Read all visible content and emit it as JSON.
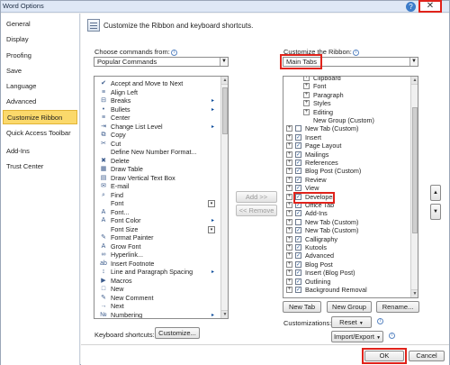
{
  "window": {
    "title": "Word Options",
    "help_glyph": "?",
    "close_glyph": "✕"
  },
  "sidebar": {
    "items": [
      {
        "label": "General"
      },
      {
        "label": "Display"
      },
      {
        "label": "Proofing"
      },
      {
        "label": "Save"
      },
      {
        "label": "Language"
      },
      {
        "label": "Advanced"
      },
      {
        "label": "Customize Ribbon",
        "active": true
      },
      {
        "label": "Quick Access Toolbar"
      },
      {
        "label": "Add-Ins"
      },
      {
        "label": "Trust Center"
      }
    ]
  },
  "header": {
    "text": "Customize the Ribbon and keyboard shortcuts."
  },
  "left_panel": {
    "choose_label": "Choose commands from:",
    "choose_value": "Popular Commands",
    "commands": [
      {
        "label": "Accept and Move to Next",
        "icon": "✔",
        "sub": ""
      },
      {
        "label": "Align Left",
        "icon": "≡",
        "sub": ""
      },
      {
        "label": "Breaks",
        "icon": "⊟",
        "sub": "▸"
      },
      {
        "label": "Bullets",
        "icon": "•",
        "sub": "▸"
      },
      {
        "label": "Center",
        "icon": "≡",
        "sub": ""
      },
      {
        "label": "Change List Level",
        "icon": "⇥",
        "sub": "▸"
      },
      {
        "label": "Copy",
        "icon": "⧉",
        "sub": ""
      },
      {
        "label": "Cut",
        "icon": "✂",
        "sub": ""
      },
      {
        "label": "Define New Number Format...",
        "icon": "",
        "sub": ""
      },
      {
        "label": "Delete",
        "icon": "✖",
        "sub": ""
      },
      {
        "label": "Draw Table",
        "icon": "▦",
        "sub": ""
      },
      {
        "label": "Draw Vertical Text Box",
        "icon": "▤",
        "sub": ""
      },
      {
        "label": "E-mail",
        "icon": "✉",
        "sub": ""
      },
      {
        "label": "Find",
        "icon": "⌕",
        "sub": ""
      },
      {
        "label": "Font",
        "icon": "",
        "sub": "box"
      },
      {
        "label": "Font...",
        "icon": "A",
        "sub": ""
      },
      {
        "label": "Font Color",
        "icon": "A",
        "sub": "▸"
      },
      {
        "label": "Font Size",
        "icon": "",
        "sub": "box"
      },
      {
        "label": "Format Painter",
        "icon": "✎",
        "sub": ""
      },
      {
        "label": "Grow Font",
        "icon": "A",
        "sub": ""
      },
      {
        "label": "Hyperlink...",
        "icon": "∞",
        "sub": ""
      },
      {
        "label": "Insert Footnote",
        "icon": "ab",
        "sub": ""
      },
      {
        "label": "Line and Paragraph Spacing",
        "icon": "↕",
        "sub": "▸"
      },
      {
        "label": "Macros",
        "icon": "▶",
        "sub": ""
      },
      {
        "label": "New",
        "icon": "□",
        "sub": ""
      },
      {
        "label": "New Comment",
        "icon": "✎",
        "sub": ""
      },
      {
        "label": "Next",
        "icon": "→",
        "sub": ""
      },
      {
        "label": "Numbering",
        "icon": "№",
        "sub": "▸"
      }
    ],
    "keyboard_label": "Keyboard shortcuts:",
    "customize_button": "Customize..."
  },
  "middle": {
    "add_button": "Add >>",
    "remove_button": "<< Remove"
  },
  "right_panel": {
    "ribbon_label": "Customize the Ribbon:",
    "ribbon_value": "Main Tabs",
    "tree": [
      {
        "label": "Clipboard",
        "level": 2,
        "exp": "+",
        "chk": "none"
      },
      {
        "label": "Font",
        "level": 2,
        "exp": "+",
        "chk": "none"
      },
      {
        "label": "Paragraph",
        "level": 2,
        "exp": "+",
        "chk": "none"
      },
      {
        "label": "Styles",
        "level": 2,
        "exp": "+",
        "chk": "none"
      },
      {
        "label": "Editing",
        "level": 2,
        "exp": "+",
        "chk": "none"
      },
      {
        "label": "New Group (Custom)",
        "level": 2,
        "exp": "",
        "chk": "none"
      },
      {
        "label": "New Tab (Custom)",
        "level": 1,
        "exp": "+",
        "chk": "empty"
      },
      {
        "label": "Insert",
        "level": 1,
        "exp": "+",
        "chk": "checked"
      },
      {
        "label": "Page Layout",
        "level": 1,
        "exp": "+",
        "chk": "checked"
      },
      {
        "label": "Mailings",
        "level": 1,
        "exp": "+",
        "chk": "checked"
      },
      {
        "label": "References",
        "level": 1,
        "exp": "+",
        "chk": "checked"
      },
      {
        "label": "Blog Post (Custom)",
        "level": 1,
        "exp": "+",
        "chk": "checked"
      },
      {
        "label": "Review",
        "level": 1,
        "exp": "+",
        "chk": "checked"
      },
      {
        "label": "View",
        "level": 1,
        "exp": "+",
        "chk": "checked"
      },
      {
        "label": "Developer",
        "level": 1,
        "exp": "+",
        "chk": "checked",
        "highlight": true
      },
      {
        "label": "Office Tab",
        "level": 1,
        "exp": "+",
        "chk": "checked"
      },
      {
        "label": "Add-Ins",
        "level": 1,
        "exp": "+",
        "chk": "checked"
      },
      {
        "label": "New Tab (Custom)",
        "level": 1,
        "exp": "+",
        "chk": "empty"
      },
      {
        "label": "New Tab (Custom)",
        "level": 1,
        "exp": "+",
        "chk": "checked"
      },
      {
        "label": "Calligraphy",
        "level": 1,
        "exp": "+",
        "chk": "checked"
      },
      {
        "label": "Kutools",
        "level": 1,
        "exp": "+",
        "chk": "checked"
      },
      {
        "label": "Advanced",
        "level": 1,
        "exp": "+",
        "chk": "checked"
      },
      {
        "label": "Blog Post",
        "level": 1,
        "exp": "+",
        "chk": "checked"
      },
      {
        "label": "Insert (Blog Post)",
        "level": 1,
        "exp": "+",
        "chk": "checked"
      },
      {
        "label": "Outlining",
        "level": 1,
        "exp": "+",
        "chk": "checked"
      },
      {
        "label": "Background Removal",
        "level": 1,
        "exp": "+",
        "chk": "checked"
      }
    ],
    "new_tab_button": "New Tab",
    "new_group_button": "New Group",
    "rename_button": "Rename...",
    "customizations_label": "Customizations:",
    "reset_button": "Reset",
    "import_export_button": "Import/Export"
  },
  "footer": {
    "ok_button": "OK",
    "cancel_button": "Cancel"
  },
  "colors": {
    "highlight_red": "#e0231b",
    "active_nav": "#fbd96b"
  }
}
